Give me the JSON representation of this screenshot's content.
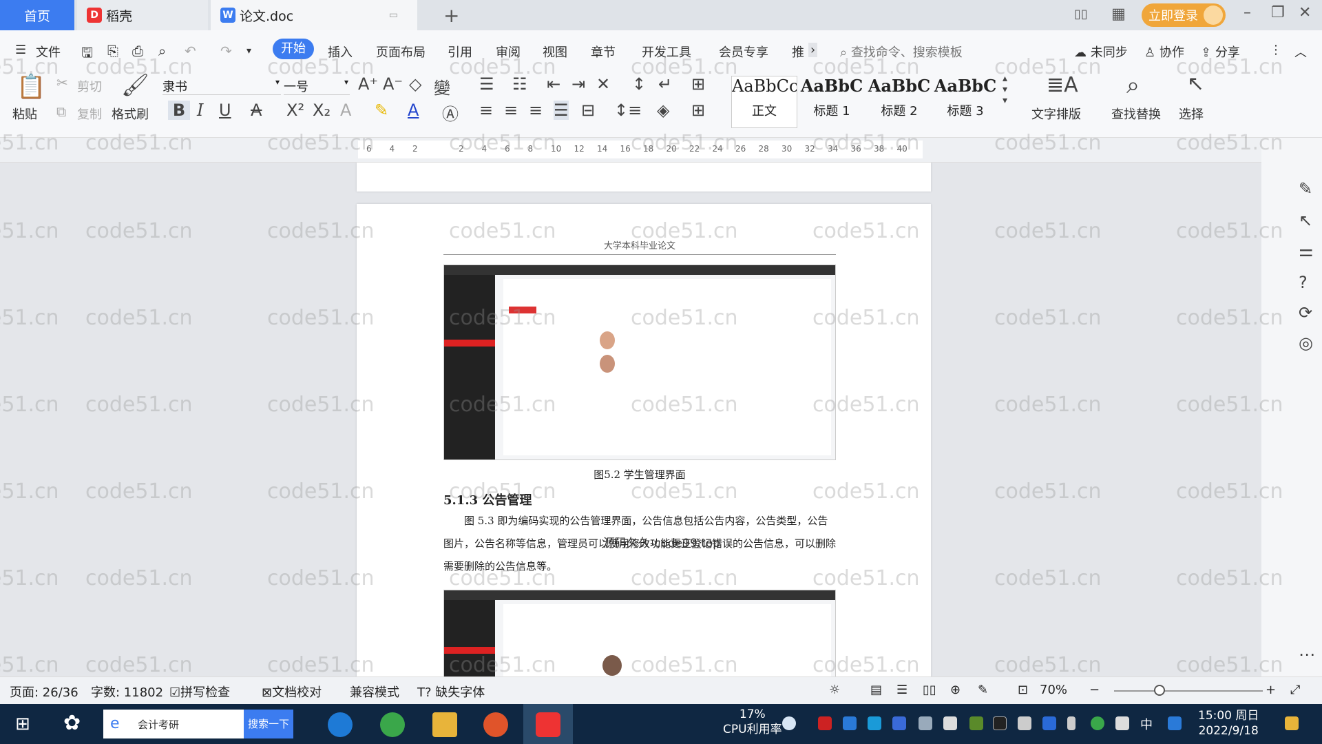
{
  "tabs": {
    "home": "首页",
    "daoke": "稻壳",
    "doc": "论文.doc"
  },
  "titlebar": {
    "login": "立即登录"
  },
  "menu": {
    "file": "文件",
    "start": "开始",
    "insert": "插入",
    "layout": "页面布局",
    "reference": "引用",
    "review": "审阅",
    "view": "视图",
    "chapter": "章节",
    "devtools": "开发工具",
    "member": "会员专享",
    "recommend": "推",
    "search_cmd": "查找命令、搜索模板",
    "unsynced": "未同步",
    "collab": "协作",
    "share": "分享"
  },
  "ribbon": {
    "paste": "粘贴",
    "cut": "剪切",
    "copy": "复制",
    "format_painter": "格式刷",
    "font": "隶书",
    "size": "一号",
    "styles": [
      {
        "preview": "AaBbCcI",
        "name": "正文"
      },
      {
        "preview": "AaBbC",
        "name": "标题 1"
      },
      {
        "preview": "AaBbC",
        "name": "标题 2"
      },
      {
        "preview": "AaBbC",
        "name": "标题 3"
      }
    ],
    "text_layout": "文字排版",
    "find_replace": "查找替换",
    "select": "选择"
  },
  "ruler": {
    "ticks": [
      "6",
      "4",
      "2",
      "",
      "2",
      "4",
      "6",
      "8",
      "10",
      "12",
      "14",
      "16",
      "18",
      "20",
      "22",
      "24",
      "26",
      "28",
      "30",
      "32",
      "34",
      "36",
      "38",
      "40"
    ]
  },
  "document": {
    "header": "大学本科毕业论文",
    "caption": "图5.2 学生管理界面",
    "heading": "5.1.3  公告管理",
    "paragraph": "图 5.3 即为编码实现的公告管理界面，公告信息包括公告内容，公告类型，公告图片，公告名称等信息，管理员可以使用修改功能更正登记错误的公告信息，可以删除需要删除的公告信息等。",
    "watermark_center": "源码久久-code99.top"
  },
  "watermark": "code51.cn",
  "status": {
    "page": "页面: 26/36",
    "words": "字数: 11802",
    "spell": "拼写检查",
    "proof": "文档校对",
    "compat": "兼容模式",
    "missing_font": "缺失字体",
    "zoom": "70%"
  },
  "taskbar": {
    "search_text": "会计考研",
    "search_btn": "搜索一下",
    "cpu_pct": "17%",
    "cpu_label": "CPU利用率",
    "ime": "中",
    "time": "15:00 周日",
    "date": "2022/9/18"
  },
  "colors": {
    "accent": "#3c7cf0",
    "login": "#f0a63a",
    "taskbar": "#0f2742"
  }
}
